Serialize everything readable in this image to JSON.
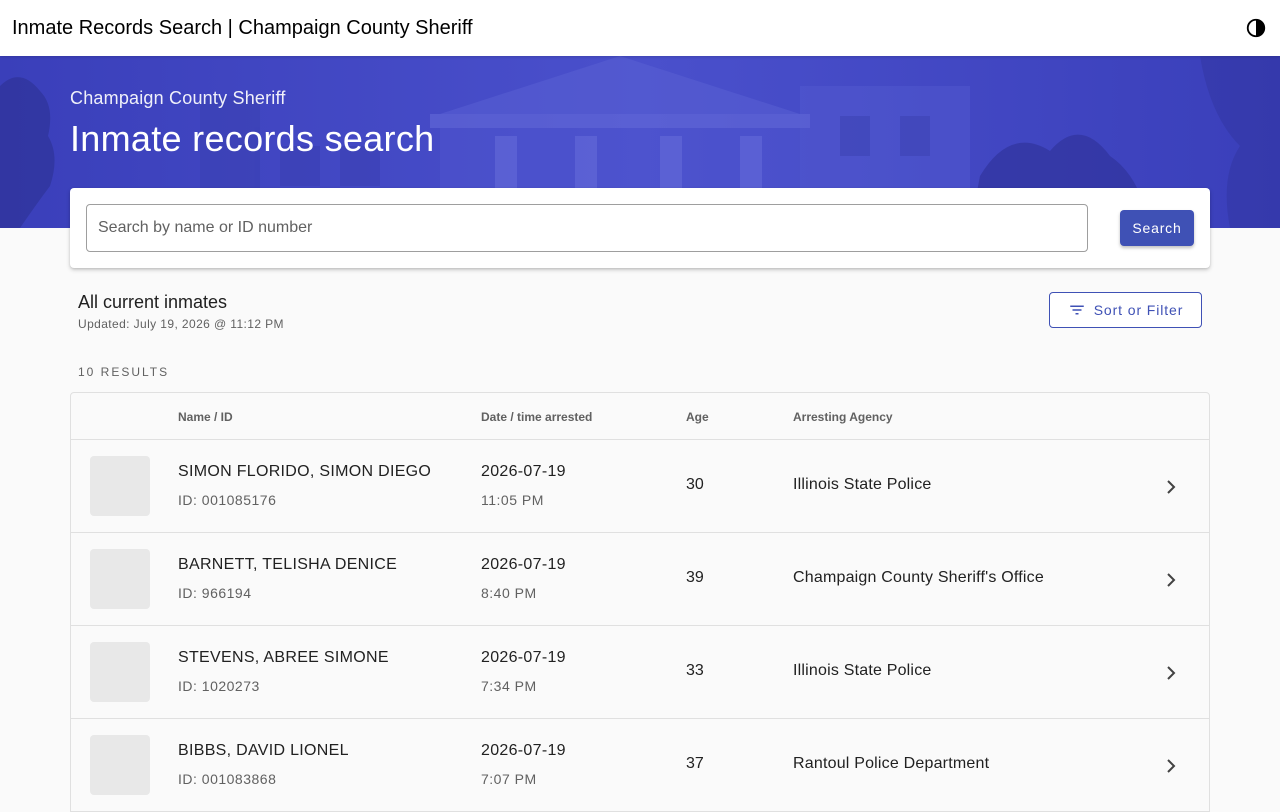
{
  "appbar": {
    "title": "Inmate Records Search | Champaign County Sheriff",
    "theme_icon": "brightness-contrast-icon"
  },
  "hero": {
    "subtitle": "Champaign County Sheriff",
    "title": "Inmate records search"
  },
  "search": {
    "placeholder": "Search by name or ID number",
    "value": "",
    "button_label": "Search"
  },
  "section": {
    "title": "All current inmates",
    "updated": "Updated: July 19, 2026 @ 11:12 PM",
    "sort_label": "Sort or Filter",
    "results_count": "10 RESULTS"
  },
  "table": {
    "headers": {
      "name": "Name / ID",
      "date": "Date / time arrested",
      "age": "Age",
      "agency": "Arresting Agency"
    },
    "rows": [
      {
        "name": "SIMON FLORIDO, SIMON DIEGO",
        "id": "ID: 001085176",
        "date": "2026-07-19",
        "time": "11:05 PM",
        "age": "30",
        "agency": "Illinois State Police"
      },
      {
        "name": "BARNETT, TELISHA DENICE",
        "id": "ID: 966194",
        "date": "2026-07-19",
        "time": "8:40 PM",
        "age": "39",
        "agency": "Champaign County Sheriff's Office"
      },
      {
        "name": "STEVENS, ABREE SIMONE",
        "id": "ID: 1020273",
        "date": "2026-07-19",
        "time": "7:34 PM",
        "age": "33",
        "agency": "Illinois State Police"
      },
      {
        "name": "BIBBS, DAVID LIONEL",
        "id": "ID: 001083868",
        "date": "2026-07-19",
        "time": "7:07 PM",
        "age": "37",
        "agency": "Rantoul Police Department"
      }
    ]
  },
  "colors": {
    "primary": "#3f51b5",
    "hero_tint": "#3f45c6",
    "divider": "#e0e0e0",
    "secondary_text": "#616161"
  }
}
